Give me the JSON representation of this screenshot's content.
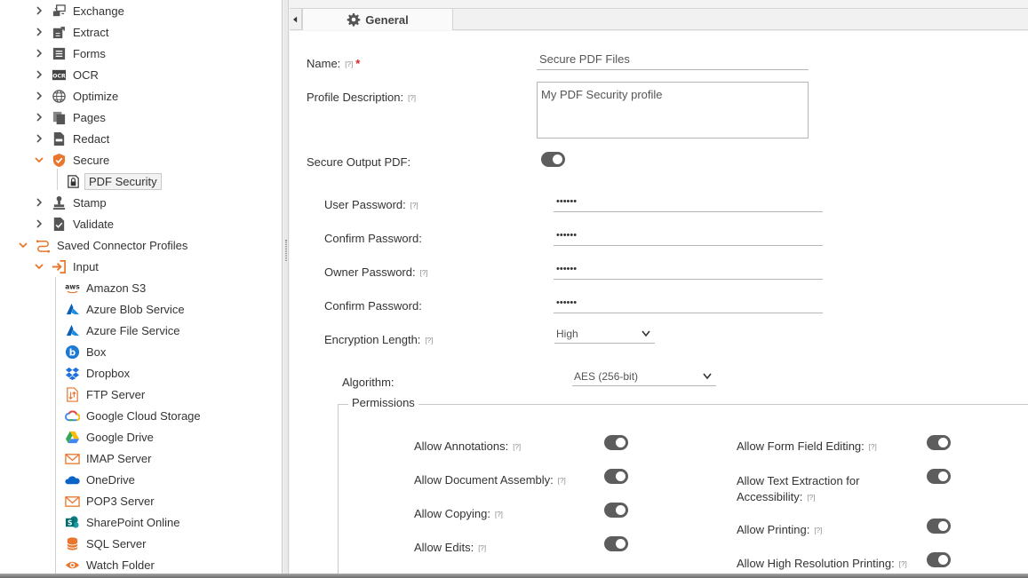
{
  "tree": {
    "items": [
      {
        "label": "Exchange",
        "icon": "exchange-icon",
        "expanded": false
      },
      {
        "label": "Extract",
        "icon": "extract-icon",
        "expanded": false
      },
      {
        "label": "Forms",
        "icon": "forms-icon",
        "expanded": false
      },
      {
        "label": "OCR",
        "icon": "ocr-icon",
        "expanded": false
      },
      {
        "label": "Optimize",
        "icon": "globe-icon",
        "expanded": false
      },
      {
        "label": "Pages",
        "icon": "pages-icon",
        "expanded": false
      },
      {
        "label": "Redact",
        "icon": "redact-icon",
        "expanded": false
      },
      {
        "label": "Secure",
        "icon": "shield-icon",
        "expanded": true
      },
      {
        "label": "PDF Security",
        "icon": "lock-icon",
        "selected": true
      },
      {
        "label": "Stamp",
        "icon": "stamp-icon",
        "expanded": false
      },
      {
        "label": "Validate",
        "icon": "validate-icon",
        "expanded": false
      },
      {
        "label": "Saved Connector Profiles",
        "icon": "connector-icon",
        "expanded": true
      },
      {
        "label": "Input",
        "icon": "input-icon",
        "expanded": true
      }
    ],
    "connectors": [
      {
        "label": "Amazon S3",
        "icon": "aws-icon"
      },
      {
        "label": "Azure Blob Service",
        "icon": "azure-icon"
      },
      {
        "label": "Azure File Service",
        "icon": "azure-icon"
      },
      {
        "label": "Box",
        "icon": "box-icon"
      },
      {
        "label": "Dropbox",
        "icon": "dropbox-icon"
      },
      {
        "label": "FTP Server",
        "icon": "ftp-icon"
      },
      {
        "label": "Google Cloud Storage",
        "icon": "google-cloud-icon"
      },
      {
        "label": "Google Drive",
        "icon": "google-drive-icon"
      },
      {
        "label": "IMAP Server",
        "icon": "mail-icon"
      },
      {
        "label": "OneDrive",
        "icon": "onedrive-icon"
      },
      {
        "label": "POP3 Server",
        "icon": "mail-icon"
      },
      {
        "label": "SharePoint Online",
        "icon": "sharepoint-icon"
      },
      {
        "label": "SQL Server",
        "icon": "database-icon"
      },
      {
        "label": "Watch Folder",
        "icon": "eye-icon"
      }
    ],
    "aws_text": "aws",
    "ocr_text": "OCR"
  },
  "tabs": {
    "general": "General"
  },
  "form": {
    "help": "[?]",
    "required_mark": "*",
    "name_label": "Name:",
    "name_value": "Secure PDF Files",
    "desc_label": "Profile Description:",
    "desc_value": "My PDF Security profile",
    "secure_output_label": "Secure Output PDF:",
    "secure_output_on": true,
    "user_pw_label": "User Password:",
    "user_pw_value": "••••••",
    "confirm_pw_label": "Confirm Password:",
    "confirm_pw_value": "••••••",
    "owner_pw_label": "Owner Password:",
    "owner_pw_value": "••••••",
    "confirm_pw2_label": "Confirm Password:",
    "confirm_pw2_value": "••••••",
    "enc_len_label": "Encryption Length:",
    "enc_len_value": "High",
    "algorithm_label": "Algorithm:",
    "algorithm_value": "AES (256-bit)"
  },
  "permissions": {
    "legend": "Permissions",
    "left": [
      {
        "label": "Allow Annotations:",
        "on": true
      },
      {
        "label": "Allow Document Assembly:",
        "on": true
      },
      {
        "label": "Allow Copying:",
        "on": true
      },
      {
        "label": "Allow Edits:",
        "on": true
      }
    ],
    "right": [
      {
        "label": "Allow Form Field Editing:",
        "on": true
      },
      {
        "label": "Allow Text Extraction for",
        "label2": "Accessibility:",
        "on": true
      },
      {
        "label": "Allow Printing:",
        "on": true
      },
      {
        "label": "Allow High Resolution Printing:",
        "on": true
      }
    ]
  },
  "colors": {
    "accent": "#e8762d",
    "toggle": "#5d5d5d",
    "required": "#d9262c"
  }
}
